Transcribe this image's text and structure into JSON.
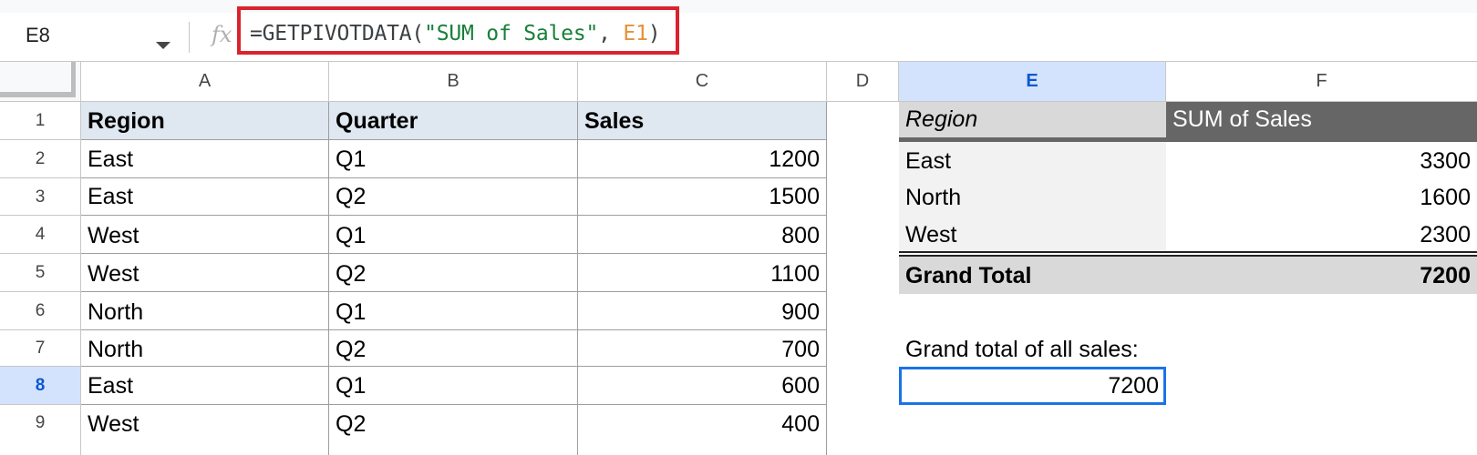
{
  "name_box": {
    "value": "E8"
  },
  "formula_bar": {
    "fx_label": "fx",
    "prefix": "=GETPIVOTDATA(",
    "string_arg": "\"SUM of Sales\"",
    "separator": ", ",
    "ref_arg": "E1",
    "suffix": ")"
  },
  "columns": [
    "A",
    "B",
    "C",
    "D",
    "E",
    "F"
  ],
  "rows": [
    "1",
    "2",
    "3",
    "4",
    "5",
    "6",
    "7",
    "8",
    "9"
  ],
  "selected": {
    "column": "E",
    "row": "8"
  },
  "source_table": {
    "headers": [
      "Region",
      "Quarter",
      "Sales"
    ],
    "rows": [
      [
        "East",
        "Q1",
        "1200"
      ],
      [
        "East",
        "Q2",
        "1500"
      ],
      [
        "West",
        "Q1",
        "800"
      ],
      [
        "West",
        "Q2",
        "1100"
      ],
      [
        "North",
        "Q1",
        "900"
      ],
      [
        "North",
        "Q2",
        "700"
      ],
      [
        "East",
        "Q1",
        "600"
      ],
      [
        "West",
        "Q2",
        "400"
      ]
    ]
  },
  "pivot_table": {
    "row_header": "Region",
    "value_header": "SUM of Sales",
    "rows": [
      {
        "label": "East",
        "value": "3300"
      },
      {
        "label": "North",
        "value": "1600"
      },
      {
        "label": "West",
        "value": "2300"
      }
    ],
    "total_label": "Grand Total",
    "total_value": "7200"
  },
  "note_label": "Grand total of all sales:",
  "result_value": "7200",
  "colors": {
    "highlight_box": "#d9232e",
    "selection": "#1a73e8",
    "selected_header_bg": "#d3e3fd",
    "pivot_dark": "#666666",
    "source_header_bg": "#dfe7f0"
  }
}
